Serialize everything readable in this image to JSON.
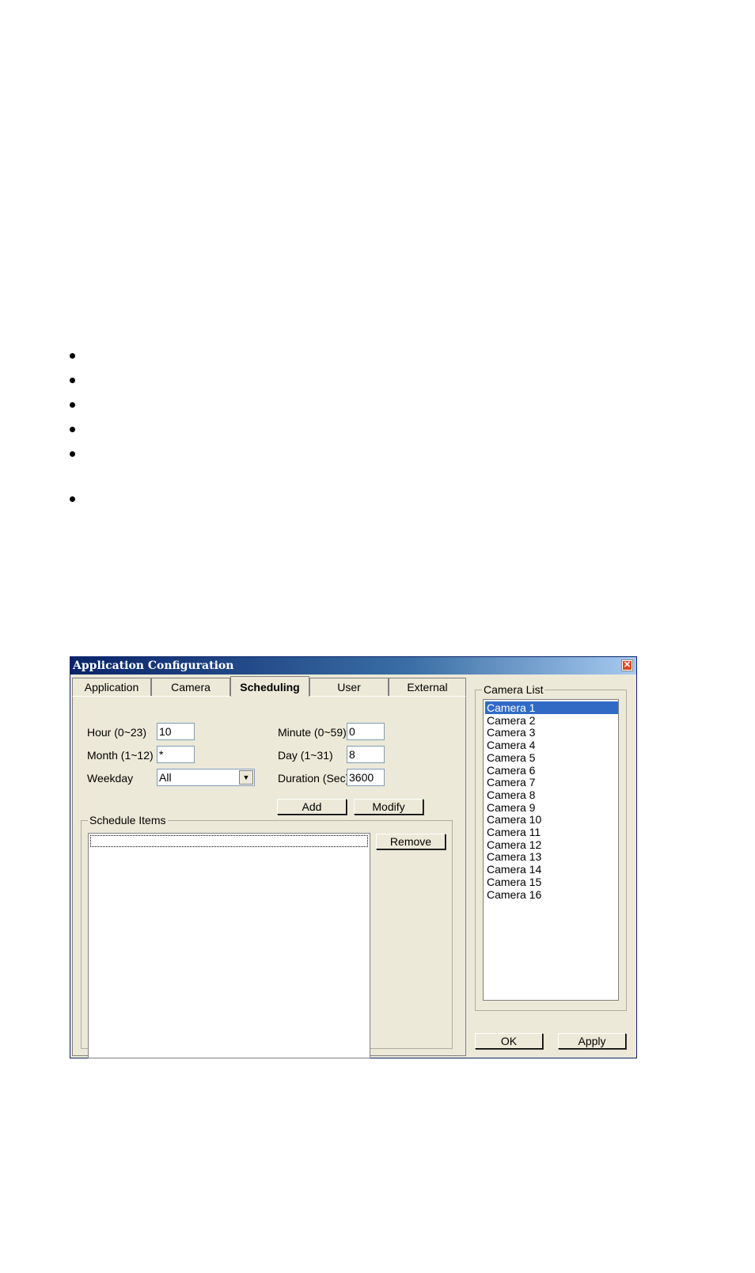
{
  "window": {
    "title": "Application Configuration"
  },
  "tabs": [
    "Application",
    "Camera",
    "Scheduling",
    "User",
    "External"
  ],
  "active_tab": "Scheduling",
  "form": {
    "hour_label": "Hour (0~23)",
    "hour_value": "10",
    "minute_label": "Minute (0~59)",
    "minute_value": "0",
    "month_label": "Month (1~12)",
    "month_value": "*",
    "day_label": "Day (1~31)",
    "day_value": "8",
    "weekday_label": "Weekday",
    "weekday_value": "All",
    "duration_label": "Duration (Sec)",
    "duration_value": "3600"
  },
  "buttons": {
    "add": "Add",
    "modify": "Modify",
    "remove": "Remove",
    "ok": "OK",
    "apply": "Apply"
  },
  "schedule_items": {
    "label": "Schedule Items"
  },
  "camera_list": {
    "label": "Camera List",
    "selected": "Camera 1",
    "items": [
      "Camera 1",
      "Camera 2",
      "Camera 3",
      "Camera 4",
      "Camera 5",
      "Camera 6",
      "Camera 7",
      "Camera 8",
      "Camera 9",
      "Camera 10",
      "Camera 11",
      "Camera 12",
      "Camera 13",
      "Camera 14",
      "Camera 15",
      "Camera 16"
    ]
  },
  "colors": {
    "title_bar": "#0a246a",
    "selection": "#316ac5",
    "dialog_bg": "#ece9d8",
    "close_button": "#d94a28"
  }
}
